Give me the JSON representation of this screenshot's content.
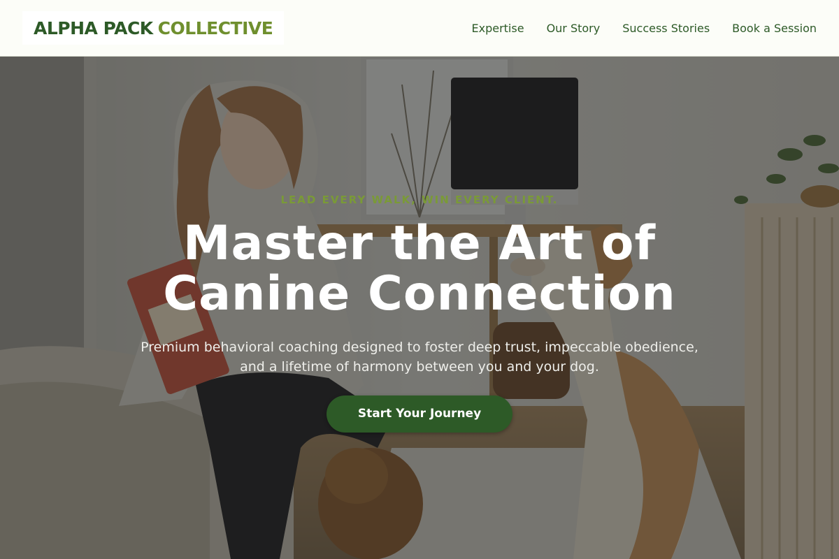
{
  "brand": {
    "name_part1": "ALPHA PACK",
    "name_part2": "COLLECTIVE",
    "color_primary": "#2d5a27",
    "color_accent": "#6f8f2e"
  },
  "nav": {
    "items": [
      "Expertise",
      "Our Story",
      "Success Stories",
      "Book a Session"
    ]
  },
  "hero": {
    "eyebrow": "LEAD EVERY WALK, WIN EVERY CLIENT.",
    "headline_line1": "Master the Art of",
    "headline_line2": "Canine Connection",
    "subheadline_line1": "Premium behavioral coaching designed to foster deep trust, impeccable obedience,",
    "subheadline_line2": "and a lifetime of harmony between you and your dog.",
    "cta_label": "Start Your Journey",
    "background_image": "woman-with-dogs-in-bedroom-photo"
  }
}
